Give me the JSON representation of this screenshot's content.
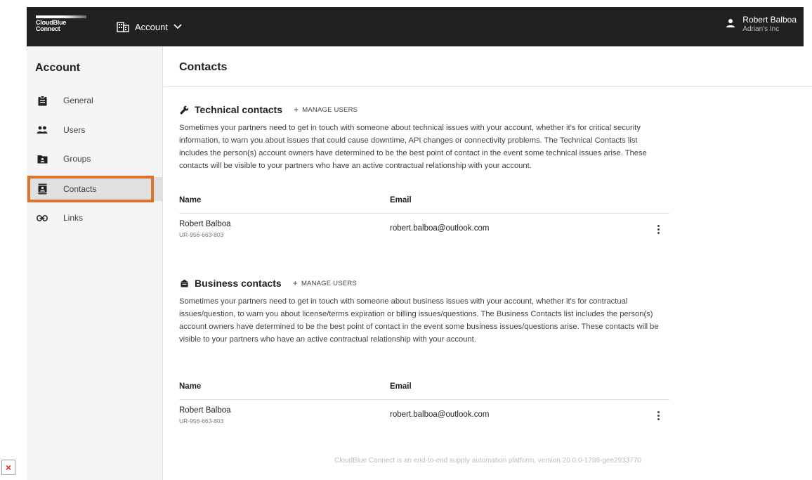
{
  "topbar": {
    "logo_line1": "CloudBlue",
    "logo_line2": "Connect",
    "account_label": "Account",
    "user_name": "Robert Balboa",
    "user_company": "Adrian's Inc"
  },
  "sidebar": {
    "title": "Account",
    "items": [
      {
        "label": "General",
        "icon": "clipboard-icon"
      },
      {
        "label": "Users",
        "icon": "users-icon"
      },
      {
        "label": "Groups",
        "icon": "folder-group-icon"
      },
      {
        "label": "Contacts",
        "icon": "contact-card-icon",
        "active": true
      },
      {
        "label": "Links",
        "icon": "link-icon"
      }
    ]
  },
  "page": {
    "title": "Contacts"
  },
  "technical": {
    "title": "Technical contacts",
    "manage_label": "MANAGE USERS",
    "description": "Sometimes your partners need to get in touch with someone about technical issues with your account, whether it's for critical security information, to warn you about issues that could cause downtime, API changes or connectivity problems. The Technical Contacts list includes the person(s) account owners have determined to be the best point of contact in the event some technical issues arise. These contacts will be visible to your partners who have an active contractual relationship with your account.",
    "columns": {
      "name": "Name",
      "email": "Email"
    },
    "rows": [
      {
        "name": "Robert Balboa",
        "id": "UR-956-663-803",
        "email": "robert.balboa@outlook.com"
      }
    ]
  },
  "business": {
    "title": "Business contacts",
    "manage_label": "MANAGE USERS",
    "description": "Sometimes your partners need to get in touch with someone about business issues with your account, whether it's for contractual issues/question, to warn you about license/terms expiration or billing issues/questions. The Business Contacts list includes the person(s) account owners have determined to be the best point of contact in the event some business issues/questions arise. These contacts will be visible to your partners who have an active contractual relationship with your account.",
    "columns": {
      "name": "Name",
      "email": "Email"
    },
    "rows": [
      {
        "name": "Robert Balboa",
        "id": "UR-956-663-803",
        "email": "robert.balboa@outlook.com"
      }
    ]
  },
  "footer": {
    "text": "CloudBlue Connect is an end-to-end supply automation platform, version 20.0.0-1788-gee2933770"
  },
  "colors": {
    "topbar": "#212121",
    "highlight": "#d9742c",
    "sidebar_bg": "#f5f5f5"
  }
}
